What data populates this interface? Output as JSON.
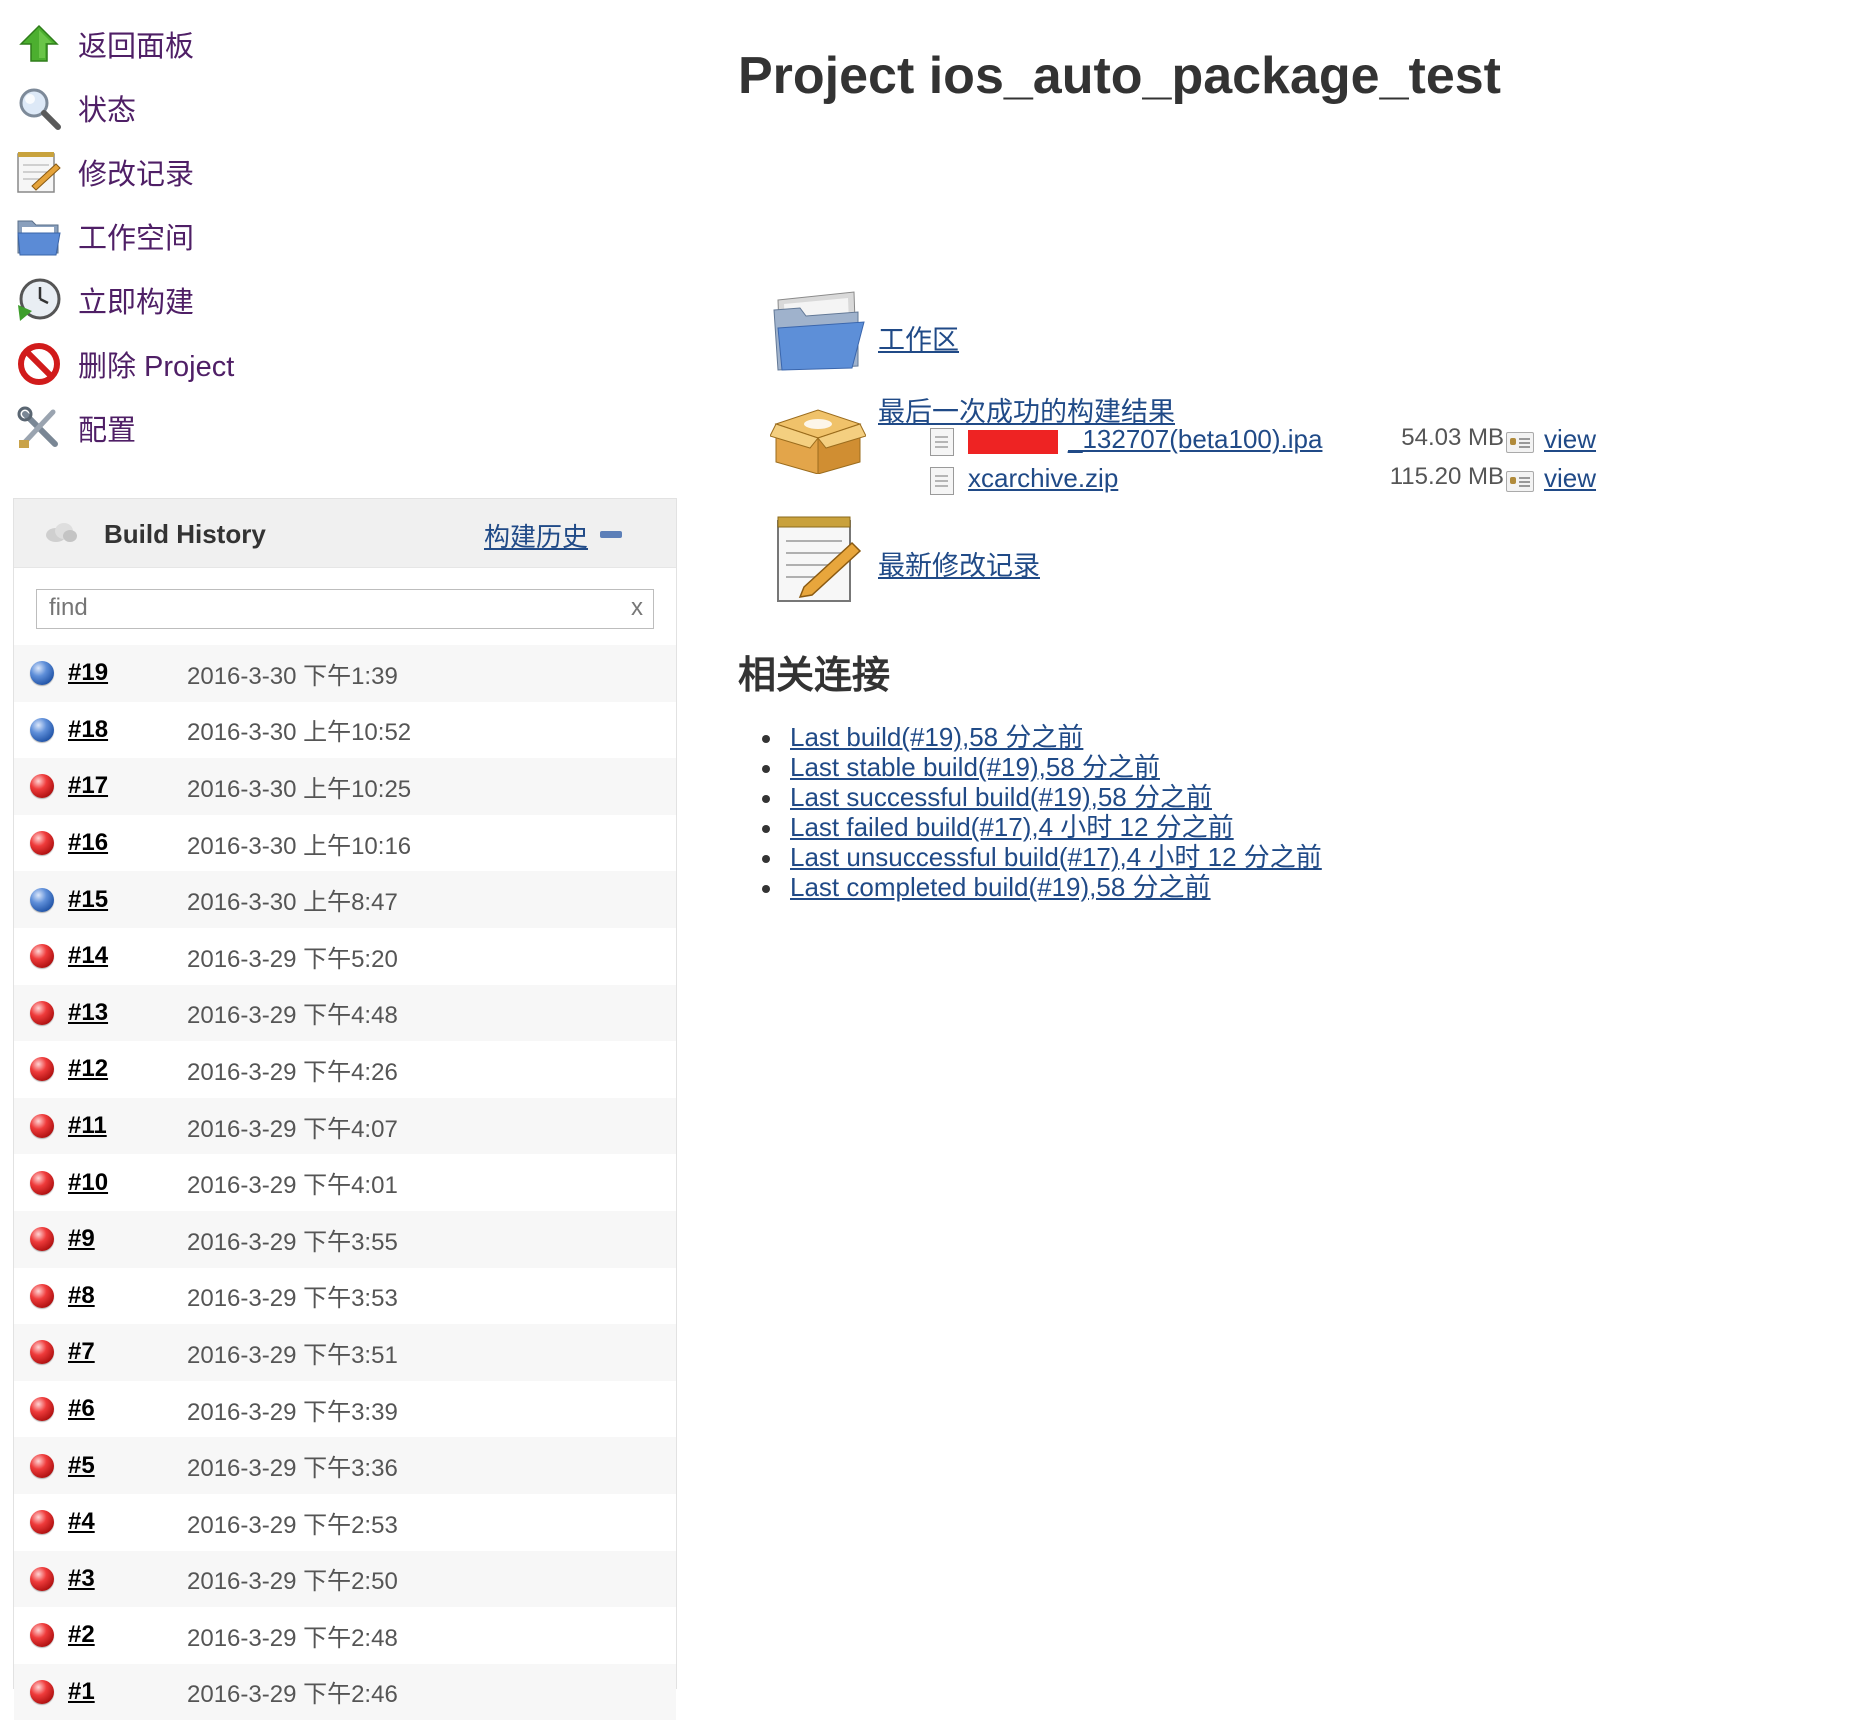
{
  "sidebar": {
    "tasks": [
      {
        "label": "返回面板",
        "icon": "up-arrow-icon"
      },
      {
        "label": "状态",
        "icon": "magnifier-icon"
      },
      {
        "label": "修改记录",
        "icon": "notepad-icon"
      },
      {
        "label": "工作空间",
        "icon": "folder-icon"
      },
      {
        "label": "立即构建",
        "icon": "clock-build-icon"
      },
      {
        "label": "删除 Project",
        "icon": "no-entry-icon"
      },
      {
        "label": "配置",
        "icon": "tools-icon"
      }
    ]
  },
  "build_history": {
    "title": "Build History",
    "trend_label": "构建历史",
    "search_placeholder": "find",
    "clear_label": "x",
    "builds": [
      {
        "number": "#19",
        "date": "2016-3-30 下午1:39",
        "status": "blue"
      },
      {
        "number": "#18",
        "date": "2016-3-30 上午10:52",
        "status": "blue"
      },
      {
        "number": "#17",
        "date": "2016-3-30 上午10:25",
        "status": "red"
      },
      {
        "number": "#16",
        "date": "2016-3-30 上午10:16",
        "status": "red"
      },
      {
        "number": "#15",
        "date": "2016-3-30 上午8:47",
        "status": "blue"
      },
      {
        "number": "#14",
        "date": "2016-3-29 下午5:20",
        "status": "red"
      },
      {
        "number": "#13",
        "date": "2016-3-29 下午4:48",
        "status": "red"
      },
      {
        "number": "#12",
        "date": "2016-3-29 下午4:26",
        "status": "red"
      },
      {
        "number": "#11",
        "date": "2016-3-29 下午4:07",
        "status": "red"
      },
      {
        "number": "#10",
        "date": "2016-3-29 下午4:01",
        "status": "red"
      },
      {
        "number": "#9",
        "date": "2016-3-29 下午3:55",
        "status": "red"
      },
      {
        "number": "#8",
        "date": "2016-3-29 下午3:53",
        "status": "red"
      },
      {
        "number": "#7",
        "date": "2016-3-29 下午3:51",
        "status": "red"
      },
      {
        "number": "#6",
        "date": "2016-3-29 下午3:39",
        "status": "red"
      },
      {
        "number": "#5",
        "date": "2016-3-29 下午3:36",
        "status": "red"
      },
      {
        "number": "#4",
        "date": "2016-3-29 下午2:53",
        "status": "red"
      },
      {
        "number": "#3",
        "date": "2016-3-29 下午2:50",
        "status": "red"
      },
      {
        "number": "#2",
        "date": "2016-3-29 下午2:48",
        "status": "red"
      },
      {
        "number": "#1",
        "date": "2016-3-29 下午2:46",
        "status": "red"
      }
    ]
  },
  "main": {
    "title": "Project ios_auto_package_test",
    "workspace_label": "工作区",
    "artifacts_title": "最后一次成功的构建结果",
    "artifacts": [
      {
        "name": "_132707(beta100).ipa",
        "size": "54.03 MB",
        "view": "view"
      },
      {
        "name": "xcarchive.zip",
        "size": "115.20 MB",
        "view": "view"
      }
    ],
    "changes_label": "最新修改记录",
    "related_title": "相关连接",
    "permalinks": [
      "Last build(#19),58 分之前",
      "Last stable build(#19),58 分之前",
      "Last successful build(#19),58 分之前",
      "Last failed build(#17),4 小时 12 分之前",
      "Last unsuccessful build(#17),4 小时 12 分之前",
      "Last completed build(#19),58 分之前"
    ]
  }
}
